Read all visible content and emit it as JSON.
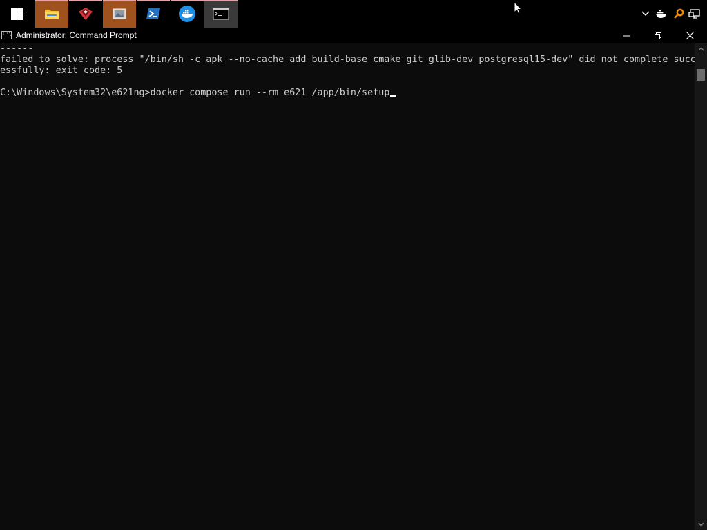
{
  "taskbar": {
    "apps": [
      {
        "name": "file-explorer",
        "icon": "folder-icon",
        "open": true
      },
      {
        "name": "cleanmymac",
        "icon": "red-shield-icon",
        "open": true
      },
      {
        "name": "photos",
        "icon": "photos-icon",
        "open": true
      },
      {
        "name": "powershell",
        "icon": "powershell-icon",
        "open": true
      },
      {
        "name": "docker-desktop",
        "icon": "docker-icon",
        "open": true
      },
      {
        "name": "command-prompt",
        "icon": "cmd-icon",
        "open": true,
        "active": true
      }
    ],
    "tray_icons": [
      "chevron-down-icon",
      "docker-tray-icon",
      "search-tray-icon",
      "network-icon"
    ],
    "accent_color": "#e8a0a8"
  },
  "window": {
    "title": "Administrator: Command Prompt",
    "minimize_symbol": "—",
    "restore_symbol": "❐",
    "close_symbol": "✕"
  },
  "console": {
    "lines": [
      "------",
      "failed to solve: process \"/bin/sh -c apk --no-cache add build-base cmake git glib-dev postgresql15-dev\" did not complete succ",
      "essfully: exit code: 5",
      "",
      "C:\\Windows\\System32\\e621ng>docker compose run --rm e621 /app/bin/setup"
    ],
    "text_color": "#cccccc",
    "background_color": "#0c0c0c"
  }
}
